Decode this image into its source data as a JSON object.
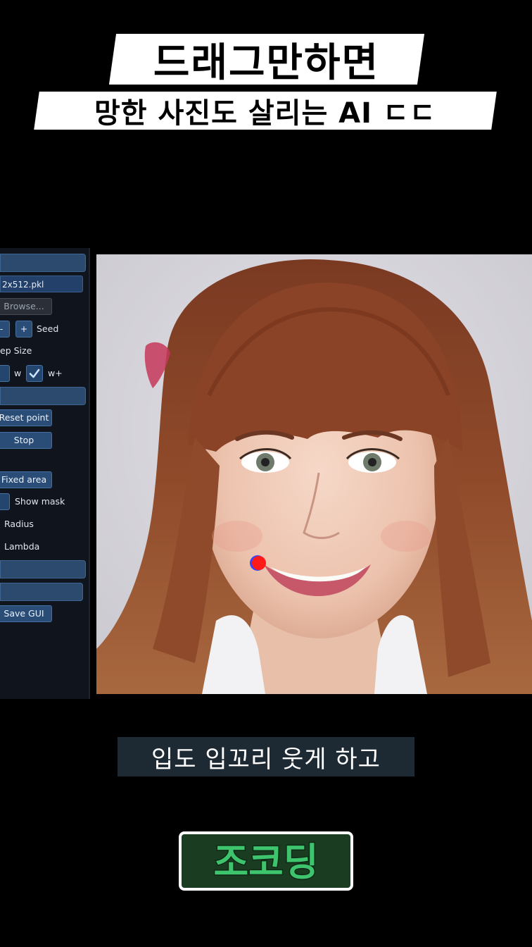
{
  "headline": {
    "line1": "드래그만하면",
    "line2": "망한 사진도 살리는 AI ㄷㄷ"
  },
  "panel": {
    "model_file": "2x512.pkl",
    "browse_label": "Browse...",
    "minus_label": "-",
    "plus_label": "+",
    "seed_label": "Seed",
    "step_size_label": "ep Size",
    "w_label": "w",
    "wplus_label": "w+",
    "wplus_checked": true,
    "reset_point_label": "Reset point",
    "stop_label": "Stop",
    "fixed_area_label": "Fixed area",
    "show_mask_label": "Show mask",
    "radius_label": "Radius",
    "lambda_label": "Lambda",
    "save_gui_label": "Save GUI"
  },
  "photo": {
    "drag_point_color": "#ff1a1a",
    "drag_point_outline": "#3344ff"
  },
  "subtitle": "입도 입꼬리 웃게 하고",
  "channel_logo": "조코딩",
  "colors": {
    "background": "#000000",
    "panel_bg": "#10141c",
    "button_blue": "#2a4d78",
    "logo_green": "#3ec46d"
  }
}
